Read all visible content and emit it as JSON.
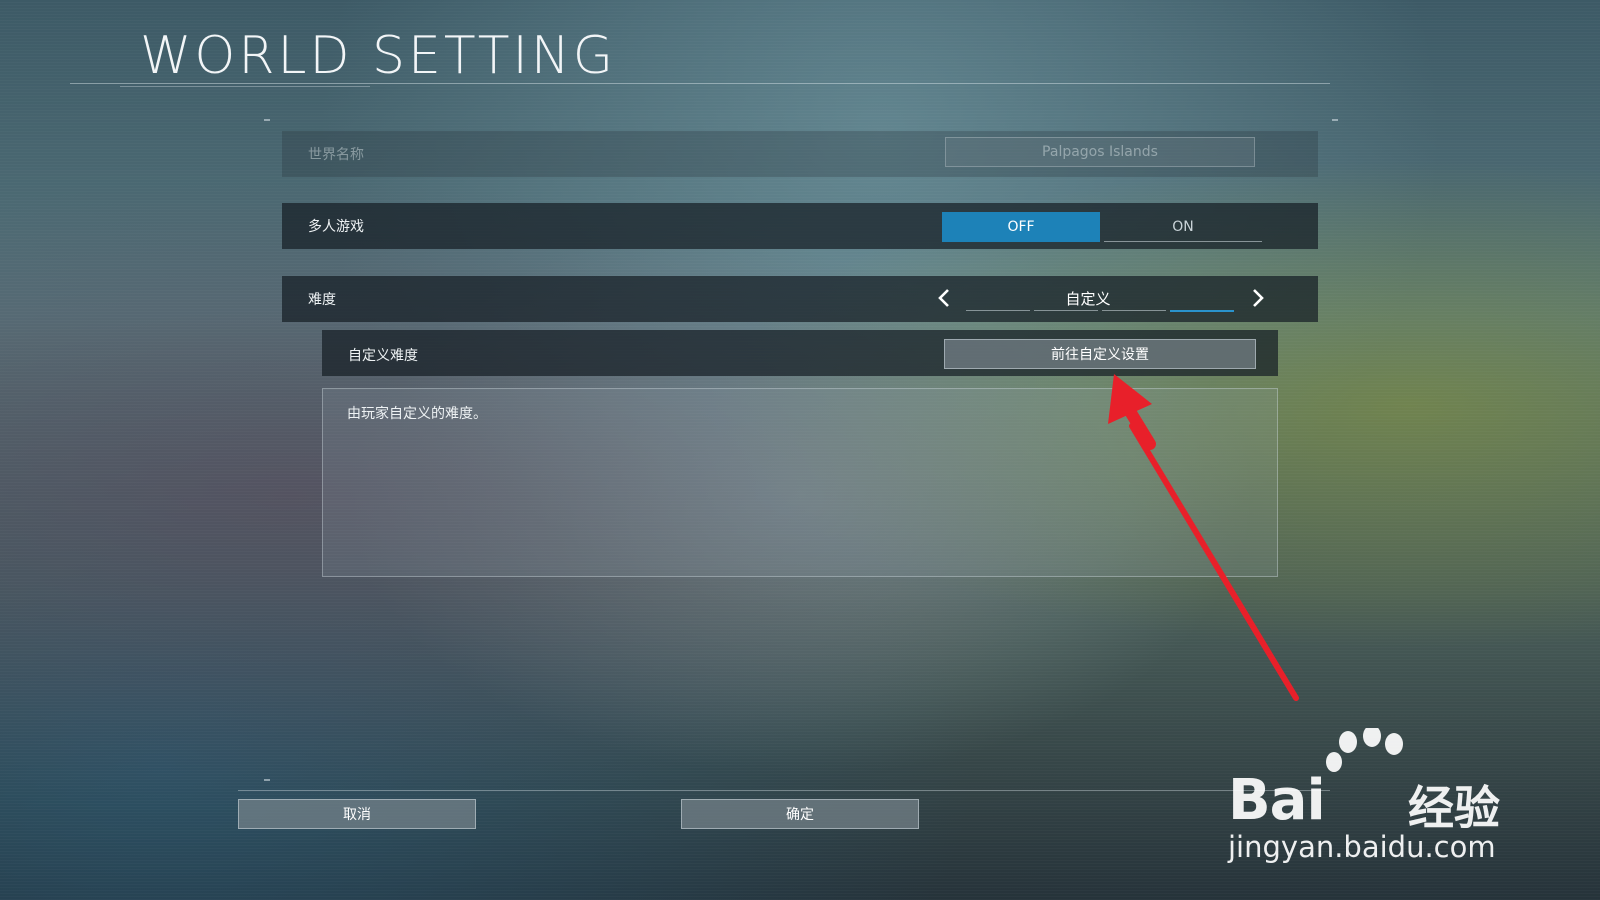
{
  "title": "WORLD SETTING",
  "world_name": {
    "label": "世界名称",
    "value": "Palpagos Islands"
  },
  "multiplayer": {
    "label": "多人游戏",
    "options": [
      "OFF",
      "ON"
    ],
    "selected": "OFF"
  },
  "difficulty": {
    "label": "难度",
    "value": "自定义",
    "segment_count": 4,
    "active_segment": 4
  },
  "custom_difficulty": {
    "label": "自定义难度",
    "button": "前往自定义设置"
  },
  "description": "由玩家自定义的难度。",
  "footer": {
    "cancel": "取消",
    "confirm": "确定"
  },
  "watermark": {
    "brand": "Bai",
    "brand_cn": "经验",
    "url": "jingyan.baidu.com"
  },
  "colors": {
    "accent": "#1d82b8",
    "annotation_arrow": "#e8202a"
  }
}
